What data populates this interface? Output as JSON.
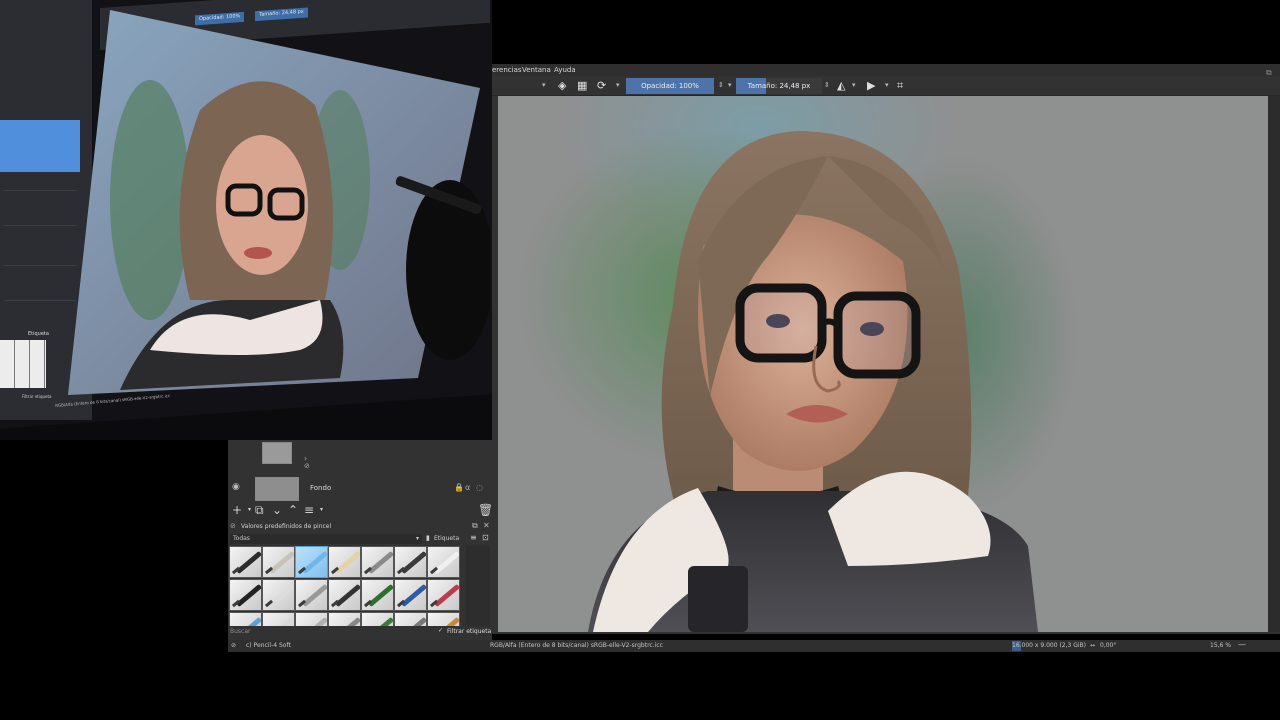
{
  "photo": {
    "small_toolbar": {
      "opacity": "Opacidad: 100%",
      "size": "Tamaño: 24,48 px"
    },
    "small_panel": {
      "tag_label": "Etiqueta",
      "filter_label": "Filtrar etiqueta"
    },
    "small_status": "RGB/Alfa (Entero de 8 bits/canal)  sRGB-elle-V2-srgbtrc.icc"
  },
  "panel": {
    "layer_name": "Fondo",
    "presets_title": "Valores predefinidos de pincel",
    "filter_value": "Todas",
    "tag_label": "Etiqueta",
    "search_placeholder": "Buscar",
    "filter_tag_label": "Filtrar etiqueta"
  },
  "menubar": {
    "items": [
      "erencias",
      "Ventana",
      "Ayuda"
    ]
  },
  "toolbar": {
    "opacity_label": "Opacidad: 100%",
    "opacity_fraction": 1.0,
    "size_label": "Tamaño: 24,48 px",
    "size_fraction": 0.35
  },
  "statusbar": {
    "brush_name": "c) Pencil-4 Soft",
    "color_profile": "RGB/Alfa (Entero de 8 bits/canal)  sRGB-elle-V2-srgbtrc.icc",
    "image_size": "16.000 x 9.000 (2,3 GiB)",
    "rotation": "0,00°",
    "zoom": "15,6 %"
  },
  "colors": {
    "accent": "#4d73a8",
    "panel_bg": "#323232",
    "canvas_bg": "#8f9090"
  }
}
